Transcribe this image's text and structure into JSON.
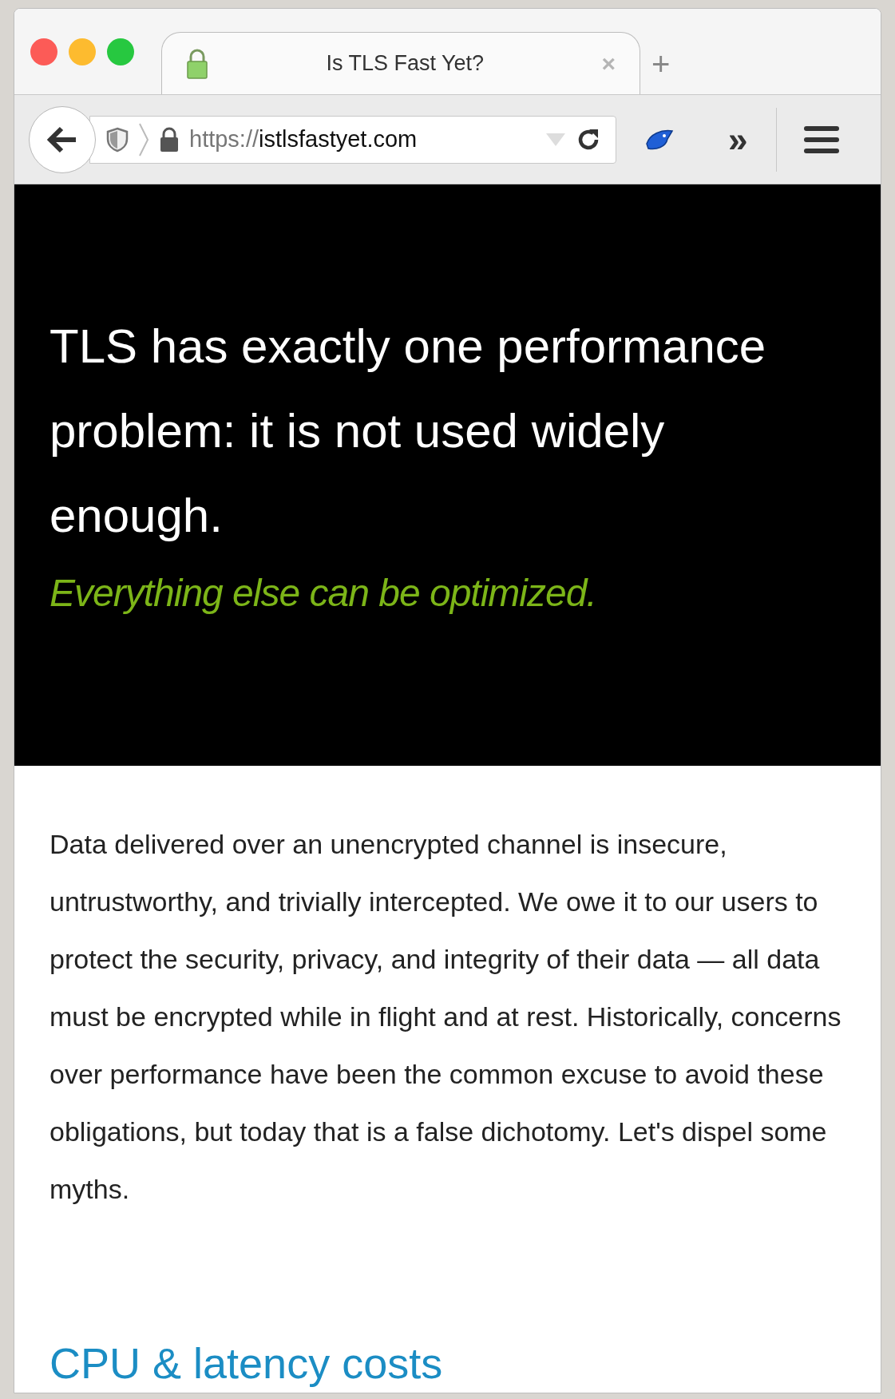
{
  "tab": {
    "title": "Is TLS Fast Yet?",
    "close": "×",
    "selected": true
  },
  "new_tab": "+",
  "address_bar": {
    "scheme": "https://",
    "host": "istlsfastyet.com"
  },
  "overflow": "»",
  "hero": {
    "heading": "TLS has exactly one performance problem: it is not used widely enough.",
    "tagline": "Everything else can be optimized."
  },
  "body": {
    "paragraph": "Data delivered over an unencrypted channel is insecure, untrustworthy, and trivially intercepted. We owe it to our users to protect the security, privacy, and integrity of their data — all data must be encrypted while in flight and at rest. Historically, concerns over performance have been the common excuse to avoid these obligations, but today that is a false dichotomy. Let's dispel some myths.",
    "section_heading": "CPU & latency costs"
  }
}
